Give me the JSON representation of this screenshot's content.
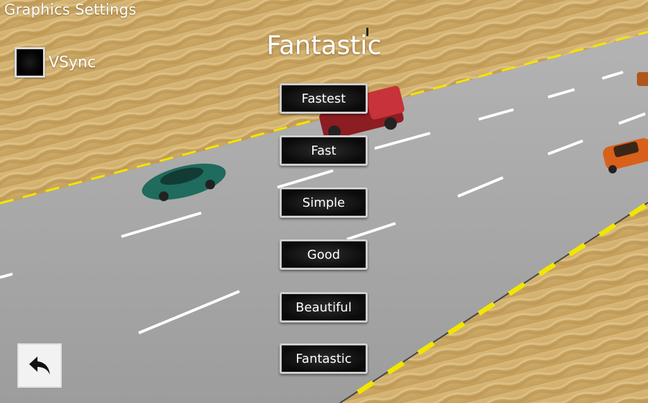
{
  "header": {
    "title": "Graphics Settings",
    "current_quality": "Fantastic"
  },
  "vsync": {
    "label": "VSync"
  },
  "quality_buttons": [
    "Fastest",
    "Fast",
    "Simple",
    "Good",
    "Beautiful",
    "Fantastic"
  ],
  "icons": {
    "back": "back-arrow-icon"
  },
  "colors": {
    "sand": "#c9a763",
    "road": "#a6a6a6",
    "lane_line": "#ffffff",
    "edge_line": "#f2e600",
    "button_bg": "#111111",
    "button_border": "#cfcfcf"
  }
}
